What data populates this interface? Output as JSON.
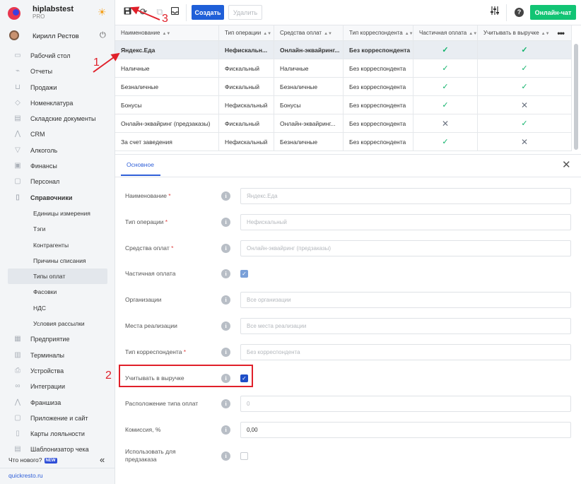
{
  "app": {
    "name": "hiplabstest",
    "plan": "PRO",
    "user": "Кирилл Рестов",
    "whats_new": "Что нового?",
    "new_badge": "NEW",
    "site": "quickresto.ru"
  },
  "nav": [
    {
      "label": "Рабочий стол",
      "icon": "desktop-icon"
    },
    {
      "label": "Отчеты",
      "icon": "chart-icon"
    },
    {
      "label": "Продажи",
      "icon": "basket-icon"
    },
    {
      "label": "Номенклатура",
      "icon": "tag-icon"
    },
    {
      "label": "Складские документы",
      "icon": "warehouse-icon"
    },
    {
      "label": "CRM",
      "icon": "crm-icon"
    },
    {
      "label": "Алкоголь",
      "icon": "glass-icon"
    },
    {
      "label": "Финансы",
      "icon": "wallet-icon"
    },
    {
      "label": "Персонал",
      "icon": "people-icon"
    },
    {
      "label": "Справочники",
      "icon": "book-icon"
    }
  ],
  "subnav": [
    "Единицы измерения",
    "Тэги",
    "Контрагенты",
    "Причины списания",
    "Типы оплат",
    "Фасовки",
    "НДС",
    "Условия рассылки"
  ],
  "nav2": [
    {
      "label": "Предприятие",
      "icon": "building-icon"
    },
    {
      "label": "Терминалы",
      "icon": "terminal-icon"
    },
    {
      "label": "Устройства",
      "icon": "printer-icon"
    },
    {
      "label": "Интеграции",
      "icon": "link-icon"
    },
    {
      "label": "Франшиза",
      "icon": "franchise-icon"
    },
    {
      "label": "Приложение и сайт",
      "icon": "app-icon"
    },
    {
      "label": "Карты лояльности",
      "icon": "card-icon"
    },
    {
      "label": "Шаблонизатор чека",
      "icon": "receipt-icon"
    }
  ],
  "toolbar": {
    "create": "Создать",
    "delete": "Удалить",
    "chat": "Онлайн-чат",
    "help": "?"
  },
  "table": {
    "headers": [
      "Наименование",
      "Тип операции",
      "Средства оплат",
      "Тип корреспондента",
      "Частичная оплата",
      "Учитывать в выручке"
    ],
    "rows": [
      {
        "name": "Яндекс.Еда",
        "op": "Нефискальн...",
        "means": "Онлайн-эквайринг...",
        "corr": "Без корреспондента",
        "partial": true,
        "revenue": true
      },
      {
        "name": "Наличные",
        "op": "Фискальный",
        "means": "Наличные",
        "corr": "Без корреспондента",
        "partial": true,
        "revenue": true
      },
      {
        "name": "Безналичные",
        "op": "Фискальный",
        "means": "Безналичные",
        "corr": "Без корреспондента",
        "partial": true,
        "revenue": true
      },
      {
        "name": "Бонусы",
        "op": "Нефискальный",
        "means": "Бонусы",
        "corr": "Без корреспондента",
        "partial": true,
        "revenue": false
      },
      {
        "name": "Онлайн-эквайринг (предзаказы)",
        "op": "Фискальный",
        "means": "Онлайн-эквайринг...",
        "corr": "Без корреспондента",
        "partial": false,
        "revenue": true
      },
      {
        "name": "За счет заведения",
        "op": "Нефискальный",
        "means": "Безналичные",
        "corr": "Без корреспондента",
        "partial": true,
        "revenue": false
      }
    ]
  },
  "panel": {
    "tab": "Основное"
  },
  "form": [
    {
      "label": "Наименование",
      "required": true,
      "kind": "input",
      "value": "Яндекс.Еда"
    },
    {
      "label": "Тип операции",
      "required": true,
      "kind": "input",
      "value": "Нефискальный"
    },
    {
      "label": "Средства оплат",
      "required": true,
      "kind": "input",
      "value": "Онлайн-эквайринг (предзаказы)"
    },
    {
      "label": "Частичная оплата",
      "required": false,
      "kind": "checkbox",
      "checked": true
    },
    {
      "label": "Организации",
      "required": false,
      "kind": "input",
      "value": "Все организации"
    },
    {
      "label": "Места реализации",
      "required": false,
      "kind": "input",
      "value": "Все места реализации"
    },
    {
      "label": "Тип корреспондента",
      "required": true,
      "kind": "input",
      "value": "Без корреспондента"
    },
    {
      "label": "Учитывать в выручке",
      "required": false,
      "kind": "checkbox",
      "checked": true
    },
    {
      "label": "Расположение типа оплат",
      "required": false,
      "kind": "input",
      "value": "0"
    },
    {
      "label": "Комиссия, %",
      "required": false,
      "kind": "input",
      "value": "0,00",
      "dark": true
    },
    {
      "label": "Использовать для предзаказа",
      "required": false,
      "kind": "checkbox",
      "checked": false
    }
  ],
  "annotations": [
    "1",
    "2",
    "3"
  ],
  "colors": {
    "accent": "#1f5fd8",
    "chat": "#12c474",
    "check": "#12b36c",
    "annotation": "#e0202a"
  }
}
